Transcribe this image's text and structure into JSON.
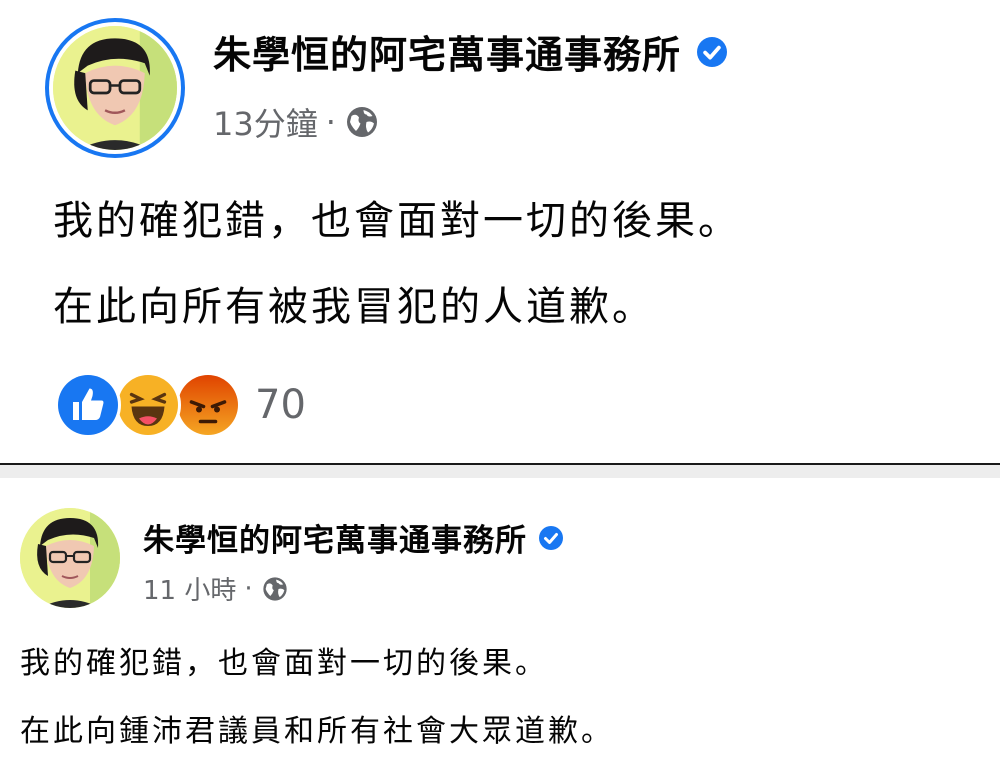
{
  "posts": [
    {
      "page_name": "朱學恒的阿宅萬事通事務所",
      "timestamp": "13分鐘",
      "lines": [
        "我的確犯錯，也會面對一切的後果。",
        "在此向所有被我冒犯的人道歉。"
      ],
      "reactions": [
        "like-icon",
        "haha-icon",
        "angry-icon"
      ],
      "reaction_count": "70"
    },
    {
      "page_name": "朱學恒的阿宅萬事通事務所",
      "timestamp": "11 小時",
      "lines": [
        "我的確犯錯，也會面對一切的後果。",
        "在此向鍾沛君議員和所有社會大眾道歉。"
      ]
    }
  ],
  "separator": "·",
  "colors": {
    "brand_blue": "#1877f2",
    "meta_gray": "#65676b",
    "like_blue": "#1877f2",
    "haha_yellow": "#f7b125",
    "angry_orange": "#e9710f"
  }
}
